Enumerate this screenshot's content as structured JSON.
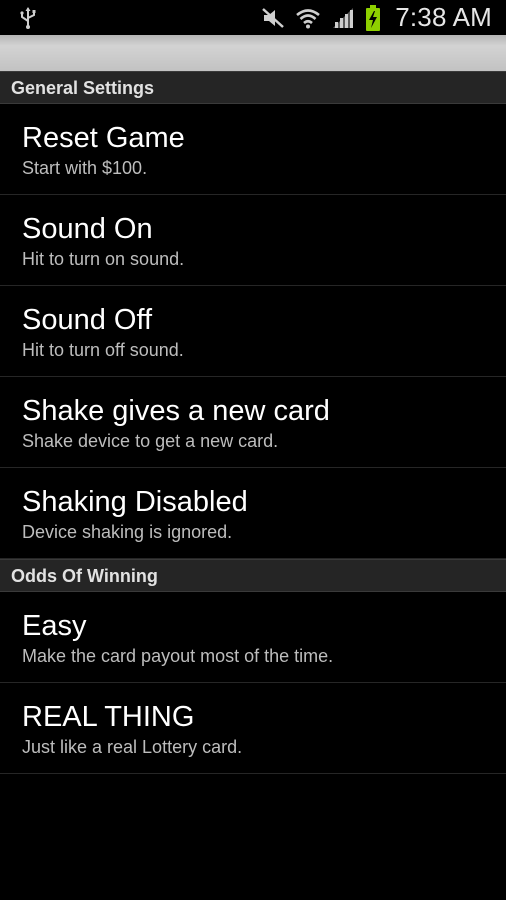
{
  "status_bar": {
    "time": "7:38 AM",
    "icons": [
      "usb-icon",
      "mute-icon",
      "wifi-icon",
      "signal-icon",
      "battery-charging-icon"
    ]
  },
  "sections": [
    {
      "header": "General Settings",
      "items": [
        {
          "title": "Reset Game",
          "summary": "Start with $100."
        },
        {
          "title": "Sound On",
          "summary": "Hit to turn on sound."
        },
        {
          "title": "Sound Off",
          "summary": "Hit to turn off sound."
        },
        {
          "title": "Shake gives a new card",
          "summary": "Shake device to get a new card."
        },
        {
          "title": "Shaking Disabled",
          "summary": "Device shaking is ignored."
        }
      ]
    },
    {
      "header": "Odds Of Winning",
      "items": [
        {
          "title": "Easy",
          "summary": "Make the card payout most of the time."
        },
        {
          "title": "REAL THING",
          "summary": "Just like a real Lottery card."
        }
      ]
    }
  ],
  "colors": {
    "background": "#000000",
    "category_bg": "#252525",
    "battery": "#8ed000"
  }
}
